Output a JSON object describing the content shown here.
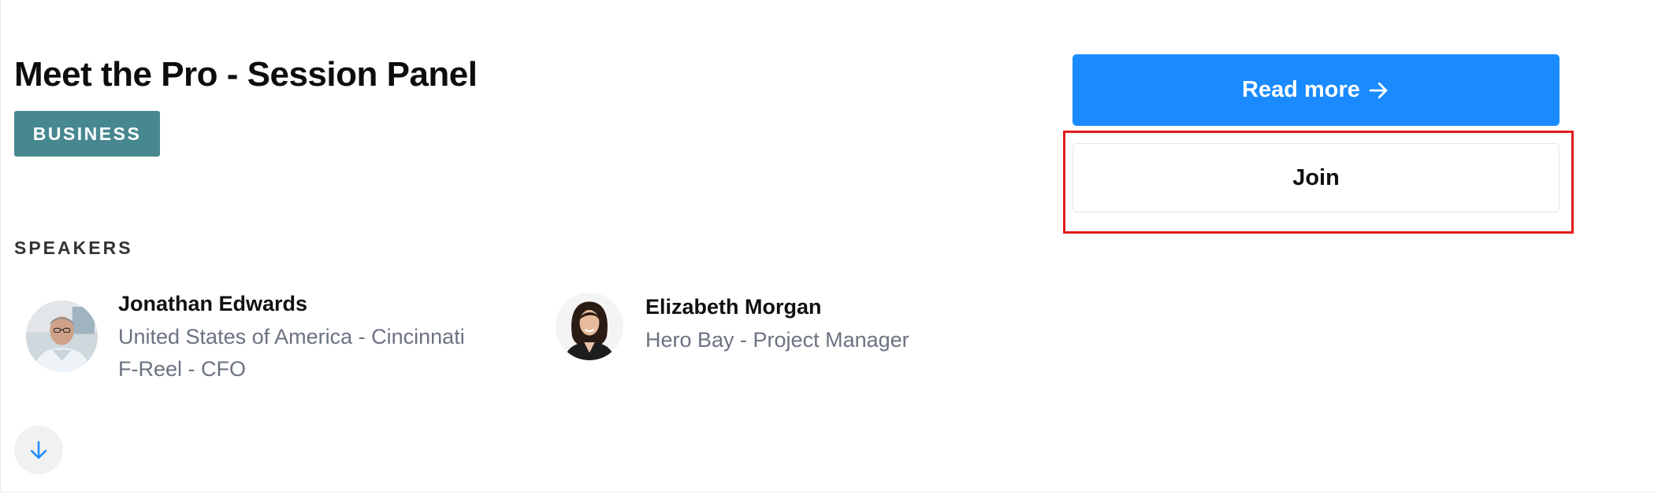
{
  "session": {
    "title": "Meet the Pro - Session Panel",
    "category_badge": "BUSINESS"
  },
  "speakers_section": {
    "label": "SPEAKERS",
    "speakers": [
      {
        "name": "Jonathan Edwards",
        "lines": [
          "United States of America - Cincinnati",
          "F-Reel - CFO"
        ],
        "avatar_icon": "photo-avatar-man"
      },
      {
        "name": "Elizabeth Morgan",
        "lines": [
          "Hero Bay - Project Manager"
        ],
        "avatar_icon": "photo-avatar-woman"
      }
    ]
  },
  "actions": {
    "read_more_label": "Read more",
    "read_more_icon": "arrow-right-icon",
    "join_label": "Join"
  },
  "scroll": {
    "icon": "arrow-down-icon"
  },
  "colors": {
    "primary": "#1a8bff",
    "badge": "#478790",
    "highlight": "#e01b1b",
    "muted_text": "#6b7280"
  }
}
